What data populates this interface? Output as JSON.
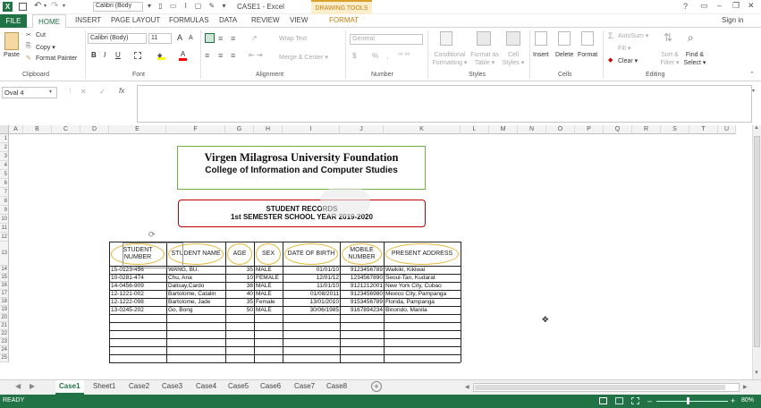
{
  "window": {
    "title": "CASE1 - Excel",
    "context_tab": "DRAWING TOOLS",
    "font_box_mini": "Calibri (Body",
    "signin": "Sign in",
    "help": "?",
    "ctrl_restore_ribbon": "▭",
    "ctrl_min": "–",
    "ctrl_max": "❐",
    "ctrl_close": "✕"
  },
  "ribbon_tabs": [
    "FILE",
    "HOME",
    "INSERT",
    "PAGE LAYOUT",
    "FORMULAS",
    "DATA",
    "REVIEW",
    "VIEW",
    "FORMAT"
  ],
  "ribbon": {
    "clipboard": {
      "paste": "Paste",
      "cut": "Cut",
      "copy": "Copy ▾",
      "format_painter": "Format Painter",
      "label": "Clipboard"
    },
    "font": {
      "name": "Calibri (Body)",
      "size": "11",
      "grow": "A",
      "shrink": "A",
      "bold": "B",
      "italic": "I",
      "underline": "U",
      "label": "Font"
    },
    "alignment": {
      "wrap": "Wrap Text",
      "merge": "Merge & Center ▾",
      "label": "Alignment"
    },
    "number": {
      "format": "General",
      "currency": "$",
      "percent": "%",
      "comma": ",",
      "label": "Number"
    },
    "styles": {
      "conditional": "Conditional Formatting ▾",
      "format_table": "Format as Table ▾",
      "cell_styles": "Cell Styles ▾",
      "label": "Styles"
    },
    "cells": {
      "insert": "Insert",
      "delete": "Delete",
      "format": "Format",
      "label": "Cells"
    },
    "editing": {
      "autosum": "AutoSum ▾",
      "fill": "Fill ▾",
      "clear": "Clear ▾",
      "sort": "Sort & Filter ▾",
      "find": "Find & Select ▾",
      "label": "Editing"
    }
  },
  "formula_bar": {
    "name_box": "Oval 4",
    "fx": "fx",
    "cancel": "✕",
    "enter": "✓",
    "value": ""
  },
  "columns": [
    "A",
    "B",
    "C",
    "D",
    "E",
    "F",
    "G",
    "H",
    "I",
    "J",
    "K",
    "L",
    "M",
    "N",
    "O",
    "P",
    "Q",
    "R",
    "S",
    "T",
    "U"
  ],
  "rows": [
    "1",
    "2",
    "3",
    "4",
    "5",
    "6",
    "7",
    "8",
    "9",
    "10",
    "11",
    "12",
    "13",
    "14",
    "15",
    "16",
    "17",
    "18",
    "19",
    "20",
    "21",
    "22",
    "23",
    "24",
    "25"
  ],
  "heading": {
    "title1": "Virgen Milagrosa University Foundation",
    "title2": "College of Information and Computer Studies",
    "records1": "STUDENT RECORDS",
    "records2": "1st SEMESTER SCHOOL YEAR 2019-2020"
  },
  "table": {
    "headers": [
      "STUDENT NUMBER",
      "STUDENT NAME",
      "AGE",
      "SEX",
      "DATE OF BIRTH",
      "MOBILE NUMBER",
      "PRESENT ADDRESS"
    ],
    "rows": [
      [
        "15-0123-456",
        "WANG, BU.",
        "35",
        "MALE",
        "01/01/10",
        "9123456789",
        "Waikiki, Kikiwai"
      ],
      [
        "10-0281-474",
        "Chu, Ana",
        "10",
        "FEMALE",
        "12/01/12",
        "1234567890",
        "Seoul-Tan, Kudarat"
      ],
      [
        "14-0456-909",
        "Dalisay,Cardo",
        "38",
        "MALE",
        "11/01/10",
        "9121212001",
        "New York City, Cubao"
      ],
      [
        "12-1221-002",
        "Bartolome, Catalin",
        "40",
        "MALE",
        "01/08/2011",
        "9123456980",
        "Mexico City, Pampanga"
      ],
      [
        "12-1222-098",
        "Bartolome, Jade",
        "35",
        "Female",
        "13/01/2010",
        "9153456789",
        "Florida, Pampanga"
      ],
      [
        "13-0245-202",
        "Go, Bong",
        "50",
        "MALE",
        "30/06/1985",
        "9167894234",
        "Binondo, Manila"
      ]
    ]
  },
  "sheets": [
    "Case1",
    "Sheet1",
    "Case2",
    "Case3",
    "Case4",
    "Case5",
    "Case6",
    "Case7",
    "Case8"
  ],
  "active_sheet": "Case1",
  "status": {
    "ready": "READY",
    "zoom": "80%",
    "minus": "–",
    "plus": "+"
  },
  "colors": {
    "excel_green": "#217346",
    "drawing_tools": "#d9a12b",
    "oval_border": "#e3b83a",
    "box_green": "#70ad47",
    "box_red": "#c00000"
  }
}
